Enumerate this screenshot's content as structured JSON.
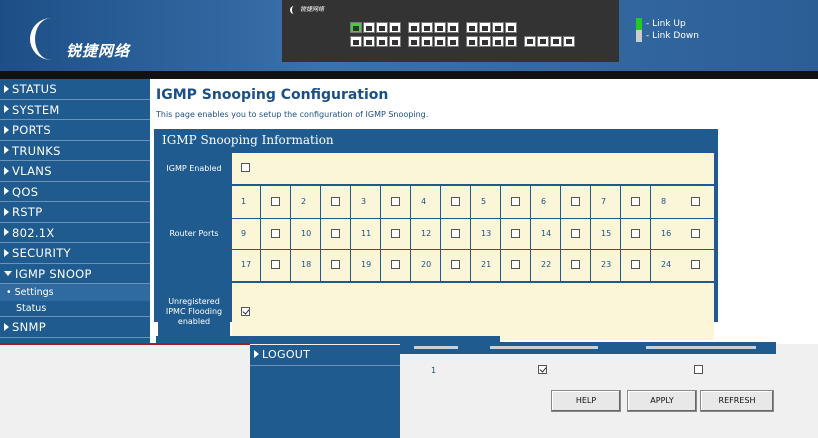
{
  "header": {
    "logo_text": "锐捷网络",
    "panel_logo_text": "锐捷网络",
    "legend": [
      {
        "label": "- Link Up",
        "color": "#22cc22"
      },
      {
        "label": "- Link Down",
        "color": "#cccccc"
      }
    ]
  },
  "sidebar": {
    "items": [
      {
        "label": "STATUS"
      },
      {
        "label": "SYSTEM"
      },
      {
        "label": "PORTS"
      },
      {
        "label": "TRUNKS"
      },
      {
        "label": "VLANS"
      },
      {
        "label": "QOS"
      },
      {
        "label": "RSTP"
      },
      {
        "label": "802.1X"
      },
      {
        "label": "SECURITY"
      },
      {
        "label": "IGMP SNOOP"
      }
    ],
    "subitems": [
      {
        "label": "Settings"
      },
      {
        "label": "Status"
      }
    ],
    "after": [
      {
        "label": "SNMP"
      }
    ],
    "logout": "LOGOUT"
  },
  "main": {
    "title": "IGMP Snooping Configuration",
    "description": "This page enables you to setup the configuration of IGMP Snooping.",
    "box_title": "IGMP Snooping Information",
    "igmp_enabled_label": "IGMP Enabled",
    "router_ports_label": "Router Ports",
    "unreg_label": "Unregistered IPMC Flooding enabled",
    "igmp_enabled": false,
    "unreg_enabled": true,
    "ports": [
      "1",
      "2",
      "3",
      "4",
      "5",
      "6",
      "7",
      "8",
      "9",
      "10",
      "11",
      "12",
      "13",
      "14",
      "15",
      "16",
      "17",
      "18",
      "19",
      "20",
      "21",
      "22",
      "23",
      "24"
    ],
    "router_port_checked": [
      false,
      false,
      false,
      false,
      false,
      false,
      false,
      false,
      false,
      false,
      false,
      false,
      false,
      false,
      false,
      false,
      false,
      false,
      false,
      false,
      false,
      false,
      false,
      false
    ]
  },
  "vlan_table": {
    "row_value": "1",
    "row_check1": true,
    "row_check2": false
  },
  "buttons": {
    "help": "HELP",
    "apply": "APPLY",
    "refresh": "REFRESH"
  }
}
